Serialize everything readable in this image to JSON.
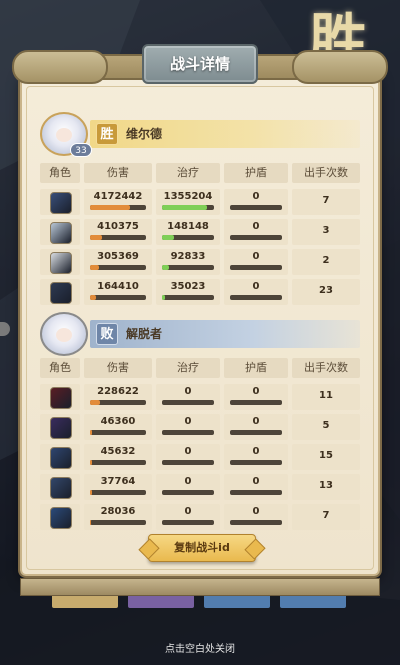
{
  "background": {
    "win_char": "胜"
  },
  "dialog": {
    "title": "战斗详情"
  },
  "columns": [
    "角色",
    "伤害",
    "治疗",
    "护盾",
    "出手次数"
  ],
  "winner": {
    "result": "胜",
    "name": "维尔德",
    "level": "33",
    "rows": [
      {
        "hero_icon": "hooded-blue-hero-icon",
        "hero_color": "#3a4f7a",
        "damage": "4172442",
        "damage_fill": 0.72,
        "healing": "1355204",
        "healing_fill": 0.86,
        "shield": "0",
        "actions": "7"
      },
      {
        "hero_icon": "white-wolf-hero-icon",
        "hero_color": "#b9c7d6",
        "damage": "410375",
        "damage_fill": 0.22,
        "healing": "148148",
        "healing_fill": 0.24,
        "shield": "0",
        "actions": "3"
      },
      {
        "hero_icon": "white-beast-hero-icon",
        "hero_color": "#d9dde2",
        "damage": "305369",
        "damage_fill": 0.16,
        "healing": "92833",
        "healing_fill": 0.14,
        "shield": "0",
        "actions": "2"
      },
      {
        "hero_icon": "dark-orb-hero-icon",
        "hero_color": "#2e3a52",
        "damage": "164410",
        "damage_fill": 0.1,
        "healing": "35023",
        "healing_fill": 0.06,
        "shield": "0",
        "actions": "23"
      }
    ]
  },
  "loser": {
    "result": "败",
    "name": "解脱者",
    "rows": [
      {
        "hero_icon": "crimson-lord-hero-icon",
        "hero_color": "#5a1e24",
        "damage": "228622",
        "damage_fill": 0.18,
        "healing": "0",
        "healing_fill": 0,
        "shield": "0",
        "actions": "11"
      },
      {
        "hero_icon": "purple-mage-hero-icon",
        "hero_color": "#3a2c5e",
        "damage": "46360",
        "damage_fill": 0.04,
        "healing": "0",
        "healing_fill": 0,
        "shield": "0",
        "actions": "5"
      },
      {
        "hero_icon": "blue-beast-hero-icon",
        "hero_color": "#2f4670",
        "damage": "45632",
        "damage_fill": 0.04,
        "healing": "0",
        "healing_fill": 0,
        "shield": "0",
        "actions": "15"
      },
      {
        "hero_icon": "blue-knight-hero-icon",
        "hero_color": "#33476a",
        "damage": "37764",
        "damage_fill": 0.03,
        "healing": "0",
        "healing_fill": 0,
        "shield": "0",
        "actions": "13"
      },
      {
        "hero_icon": "azure-dragon-hero-icon",
        "hero_color": "#2b4a7a",
        "damage": "28036",
        "damage_fill": 0.02,
        "healing": "0",
        "healing_fill": 0,
        "shield": "0",
        "actions": "7"
      }
    ]
  },
  "copy_button": {
    "label": "复制战斗id"
  },
  "close_hint": "点击空白处关闭"
}
